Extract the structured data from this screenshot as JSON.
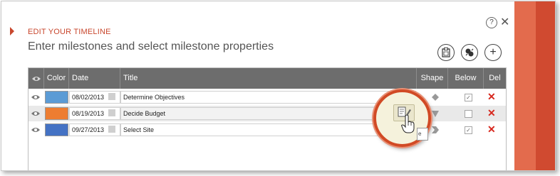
{
  "dialog": {
    "heading": "EDIT YOUR TIMELINE",
    "subheading": "Enter milestones and select milestone properties",
    "help_label": "?",
    "close_label": "✕",
    "accent_color": "#c8472d"
  },
  "toolbar": {
    "buttons": [
      {
        "icon": "clipboard-calendar-icon"
      },
      {
        "icon": "import-export-icon"
      },
      {
        "icon": "add-icon",
        "label": "+"
      }
    ]
  },
  "table": {
    "headers": {
      "visibility_icon": "eye-icon",
      "color": "Color",
      "date": "Date",
      "title": "Title",
      "shape": "Shape",
      "below": "Below",
      "del": "Del"
    },
    "rows": [
      {
        "visible": true,
        "color": "#5b9bd5",
        "date": "08/02/2013",
        "title": "Determine Objectives",
        "shape": "diamond",
        "below": true
      },
      {
        "visible": true,
        "color": "#ed7d31",
        "date": "08/19/2013",
        "title": "Decide Budget",
        "shape": "triangle-down",
        "below": false
      },
      {
        "visible": true,
        "color": "#4472c4",
        "date": "09/27/2013",
        "title": "Select Site",
        "shape": "chevron",
        "below": true
      }
    ]
  },
  "overlay": {
    "edit_icon": "edit-document-icon",
    "tooltip_fragment": "e"
  }
}
